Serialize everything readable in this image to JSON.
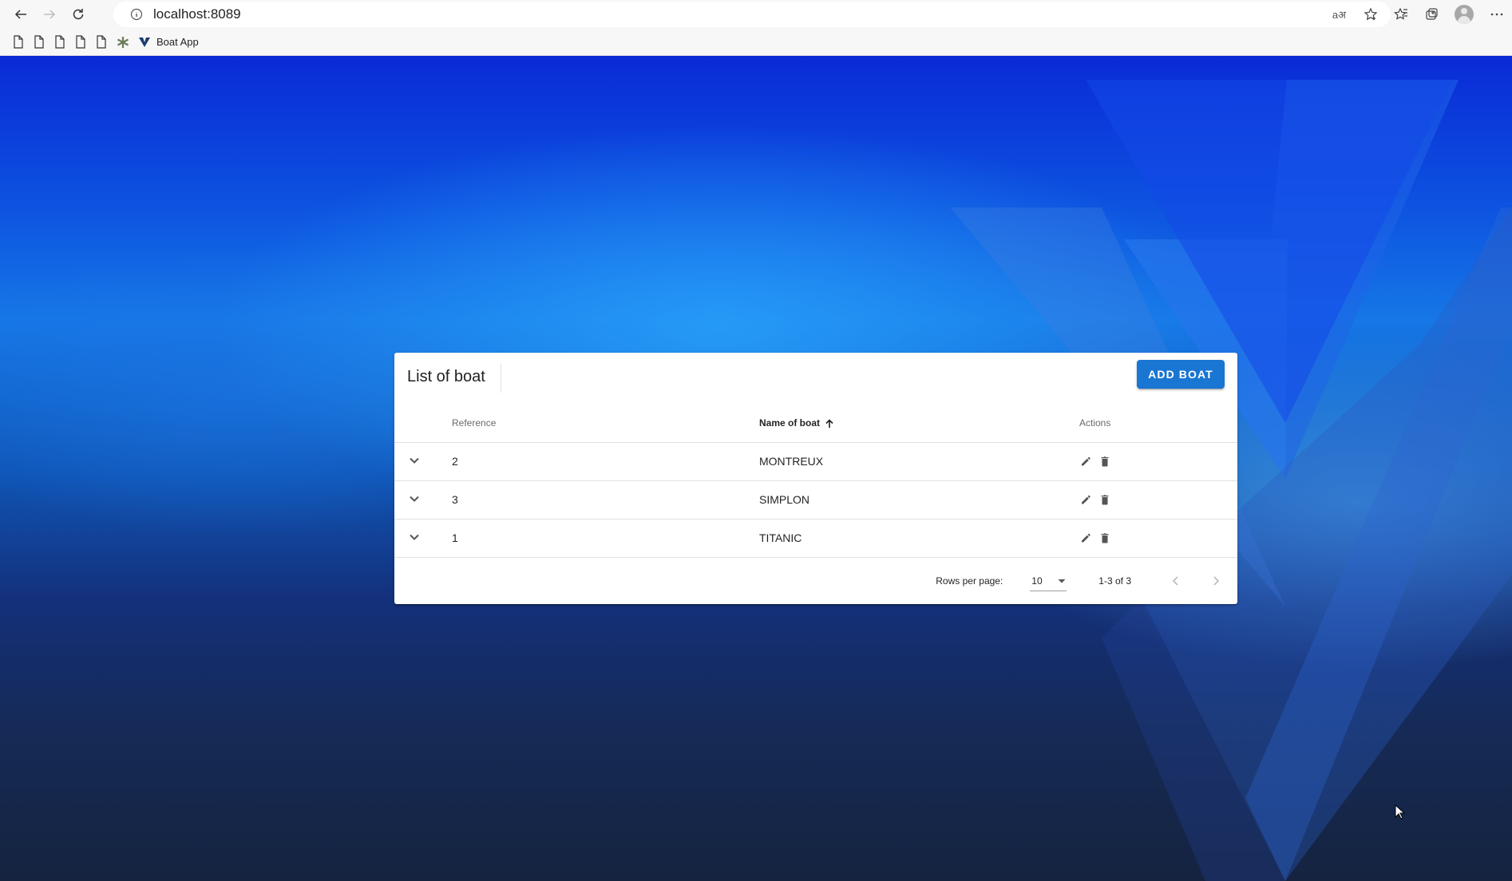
{
  "browser": {
    "url": "localhost:8089",
    "bookmarks": [
      {
        "icon": "doc-icon",
        "label": ""
      },
      {
        "icon": "doc-icon",
        "label": ""
      },
      {
        "icon": "doc-icon",
        "label": ""
      },
      {
        "icon": "doc-icon",
        "label": ""
      },
      {
        "icon": "doc-icon",
        "label": ""
      },
      {
        "icon": "asterisk-icon",
        "label": ""
      },
      {
        "icon": "vuetify-v-icon",
        "label": "Boat App"
      }
    ]
  },
  "card": {
    "title": "List of boat",
    "add_button": "ADD BOAT"
  },
  "table": {
    "headers": {
      "reference": "Reference",
      "name": "Name of boat",
      "actions": "Actions"
    },
    "sorted_by": "name",
    "sort_direction": "ascending",
    "rows": [
      {
        "reference": "2",
        "name": "MONTREUX"
      },
      {
        "reference": "3",
        "name": "SIMPLON"
      },
      {
        "reference": "1",
        "name": "TITANIC"
      }
    ]
  },
  "pagination": {
    "rows_per_page_label": "Rows per page:",
    "rows_per_page_value": "10",
    "range_text": "1-3 of 3"
  },
  "colors": {
    "accent": "#1976d2",
    "background_top": "#0a2ad6",
    "background_bottom": "#15233f"
  }
}
